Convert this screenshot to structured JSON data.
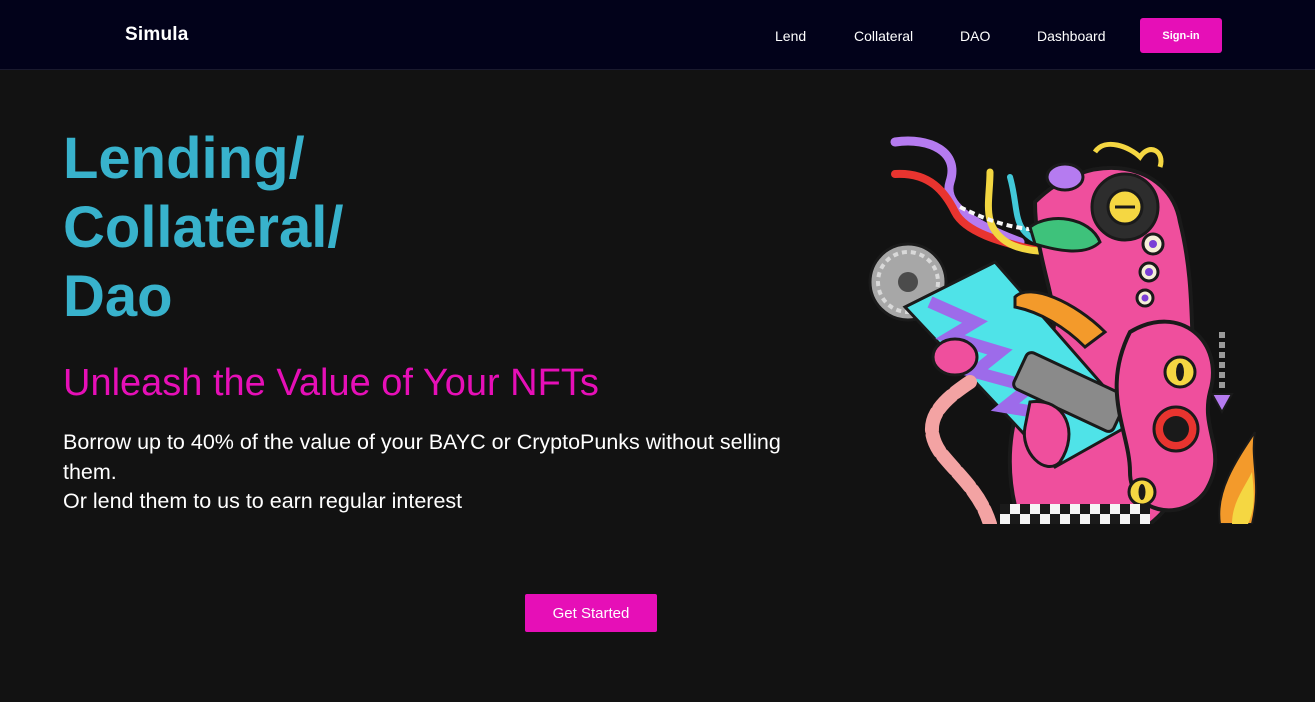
{
  "header": {
    "brand": "Simula",
    "nav": [
      {
        "label": "Lend"
      },
      {
        "label": "Collateral"
      },
      {
        "label": "DAO"
      },
      {
        "label": "Dashboard"
      }
    ],
    "signin_label": "Sign-in"
  },
  "hero": {
    "title_lines": [
      "Lending/",
      "Collateral/",
      "Dao"
    ],
    "subtitle": "Unleash the Value of Your NFTs",
    "description_lines": [
      "Borrow up to 40% of the value of your BAYC or CryptoPunks without selling them.",
      "Or lend them to us to earn regular interest"
    ],
    "cta_label": "Get Started",
    "illustration_icon": "nft-creature-illustration"
  },
  "colors": {
    "accent_pink": "#e60fb7",
    "title_teal": "#38b2cc",
    "header_bg": "#02021a",
    "page_bg": "#121212"
  }
}
